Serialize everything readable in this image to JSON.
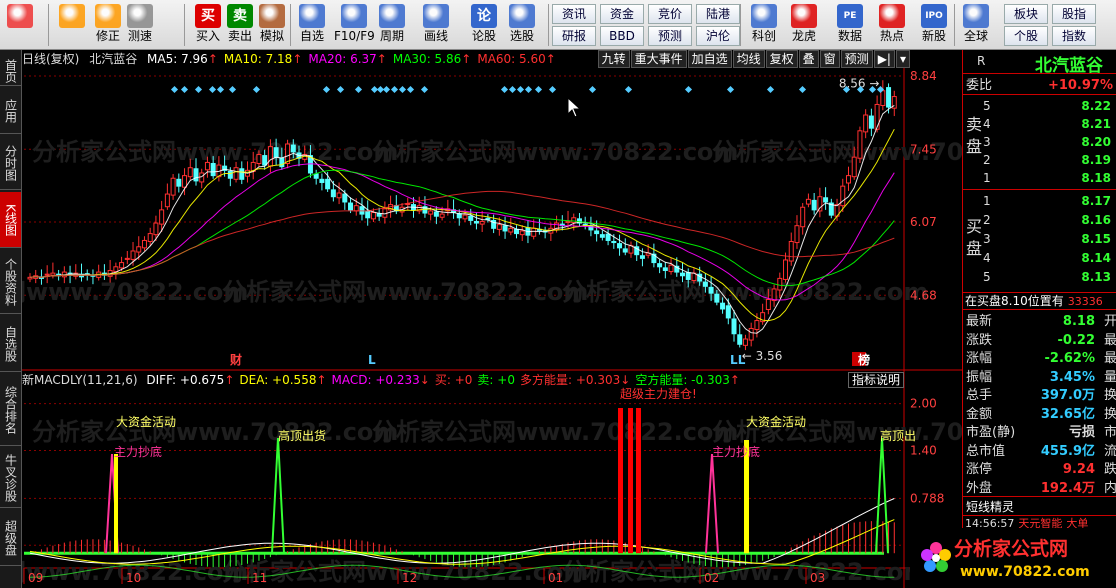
{
  "toolbar": {
    "buttons": [
      {
        "label": "",
        "icon": "windows-icon",
        "color": "#e33"
      },
      {
        "label": "",
        "icon": "back-arrow-icon",
        "color": "#f90"
      },
      {
        "label": "修正",
        "icon": "up-down-arrow-icon",
        "color": "#f90"
      },
      {
        "label": "测速",
        "icon": "clock-icon",
        "color": "#888"
      },
      {
        "label": "买入",
        "icon": "buy-icon",
        "color": "#d00",
        "glyph": "买"
      },
      {
        "label": "卖出",
        "icon": "sell-icon",
        "color": "#080",
        "glyph": "卖"
      },
      {
        "label": "模拟",
        "icon": "hammer-icon",
        "color": "#a52"
      },
      {
        "label": "自选",
        "icon": "star-icon",
        "color": "#36c"
      },
      {
        "label": "F10/F9",
        "icon": "f10-icon",
        "color": "#36c"
      },
      {
        "label": "周期",
        "icon": "period-icon",
        "color": "#36c"
      },
      {
        "label": "画线",
        "icon": "pencil-icon",
        "color": "#36c"
      },
      {
        "label": "论股",
        "icon": "discuss-icon",
        "color": "#36c",
        "glyph": "论"
      },
      {
        "label": "选股",
        "icon": "select-stock-icon",
        "color": "#36c"
      },
      {
        "label": "科创",
        "icon": "chart-icon",
        "color": "#36c"
      },
      {
        "label": "龙虎",
        "icon": "dragon-icon",
        "color": "#d00"
      },
      {
        "label": "数据",
        "icon": "pe-icon",
        "color": "#36c",
        "glyph": "PE"
      },
      {
        "label": "热点",
        "icon": "hot-icon",
        "color": "#d00"
      },
      {
        "label": "新股",
        "icon": "ipo-icon",
        "color": "#36c",
        "glyph": "IPO"
      },
      {
        "label": "全球",
        "icon": "globe-icon",
        "color": "#36c"
      }
    ],
    "small": [
      "资讯",
      "资金",
      "竞价",
      "陆港",
      "研报",
      "BBD",
      "预测",
      "沪伦",
      "板块",
      "股指",
      "个股",
      "指数"
    ]
  },
  "left_tabs": [
    {
      "label": "首页",
      "active": false
    },
    {
      "label": "应用",
      "active": false
    },
    {
      "label": "分时图",
      "active": false
    },
    {
      "label": "K线图",
      "active": true
    },
    {
      "label": "个股资料",
      "active": false
    },
    {
      "label": "自选股",
      "active": false
    },
    {
      "label": "综合排名",
      "active": false
    },
    {
      "label": "牛叉诊股",
      "active": false
    },
    {
      "label": "超级盘",
      "active": false
    }
  ],
  "kline_header": {
    "period": "日线(复权)",
    "stock": "北汽蓝谷",
    "ma": [
      {
        "label": "MA5: 7.96",
        "color": "#ffffff",
        "arrow": "↑"
      },
      {
        "label": "MA10: 7.18",
        "color": "#ffff00",
        "arrow": "↑"
      },
      {
        "label": "MA20: 6.37",
        "color": "#ff00ff",
        "arrow": "↑"
      },
      {
        "label": "MA30: 5.86",
        "color": "#00ff00",
        "arrow": "↑"
      },
      {
        "label": "MA60: 5.60",
        "color": "#ff3030",
        "arrow": "↑"
      }
    ],
    "menu": [
      "九转",
      "重大事件",
      "加自选",
      "均线",
      "复权",
      "叠",
      "窗",
      "预测",
      "▶|",
      "▾"
    ]
  },
  "chart_data": {
    "type": "candlestick",
    "price_axis": [
      "8.84",
      "7.45",
      "6.07",
      "4.68"
    ],
    "ylim": [
      3.3,
      8.84
    ],
    "high_label": "8.56",
    "low_label": "3.56",
    "markers": [
      "财",
      "L",
      "L",
      "L",
      "榜"
    ],
    "x_ticks": [
      "09",
      "10",
      "11",
      "12",
      "01",
      "02",
      "03"
    ],
    "macd_axis": [
      "2.00",
      "1.40",
      "0.788",
      "0.189"
    ],
    "macd_annotations": [
      "大资金活动",
      "主力抄底",
      "高顶出货",
      "超级主力建仓!",
      "大资金活动",
      "主力抄底",
      "高顶出"
    ],
    "closes": [
      5.02,
      5.05,
      5.0,
      5.08,
      5.1,
      5.05,
      5.12,
      5.06,
      5.1,
      5.03,
      5.08,
      5.04,
      5.12,
      5.06,
      5.15,
      5.22,
      5.3,
      5.38,
      5.52,
      5.6,
      5.72,
      5.85,
      6.05,
      6.3,
      6.6,
      6.9,
      6.75,
      6.95,
      7.1,
      6.85,
      7.0,
      7.2,
      6.95,
      7.15,
      7.05,
      6.9,
      7.1,
      6.88,
      7.05,
      7.2,
      7.35,
      7.15,
      7.5,
      7.3,
      7.12,
      7.55,
      7.4,
      7.28,
      7.35,
      7.0,
      6.9,
      6.82,
      6.7,
      6.55,
      6.62,
      6.45,
      6.3,
      6.38,
      6.22,
      6.15,
      6.25,
      6.18,
      6.32,
      6.4,
      6.28,
      6.35,
      6.42,
      6.3,
      6.38,
      6.24,
      6.28,
      6.18,
      6.22,
      6.32,
      6.25,
      6.15,
      6.2,
      6.1,
      6.05,
      6.08,
      6.12,
      5.95,
      6.02,
      5.9,
      5.95,
      5.85,
      5.9,
      5.82,
      5.95,
      5.92,
      5.88,
      5.95,
      6.05,
      6.0,
      6.08,
      6.15,
      6.05,
      6.02,
      5.92,
      5.85,
      5.78,
      5.72,
      5.68,
      5.58,
      5.5,
      5.62,
      5.45,
      5.38,
      5.48,
      5.3,
      5.22,
      5.15,
      5.25,
      5.12,
      5.05,
      4.98,
      5.1,
      4.95,
      4.85,
      4.72,
      4.55,
      4.42,
      4.25,
      3.95,
      3.75,
      3.85,
      4.05,
      4.2,
      4.35,
      4.6,
      4.8,
      5.0,
      5.35,
      5.7,
      6.0,
      6.35,
      6.5,
      6.3,
      6.55,
      6.45,
      6.2,
      6.4,
      6.75,
      6.95,
      7.3,
      7.8,
      8.1,
      7.85,
      8.3,
      8.56,
      8.25,
      8.45
    ],
    "series_colors": {
      "ma5": "#ffffff",
      "ma10": "#ffff00",
      "ma20": "#ff00ff",
      "ma30": "#00ff00",
      "ma60": "#ff3030"
    }
  },
  "macd_header": {
    "name": "新MACDLY(11,21,6)",
    "items": [
      {
        "label": "DIFF: +0.675",
        "color": "#ffffff",
        "arrow": "↑"
      },
      {
        "label": "DEA: +0.558",
        "color": "#ffff00",
        "arrow": "↑"
      },
      {
        "label": "MACD: +0.233",
        "color": "#ff00ff",
        "arrow": "↓"
      },
      {
        "label": "买: +0",
        "color": "#ff3030",
        "arrow": ""
      },
      {
        "label": "卖: +0",
        "color": "#00ff00",
        "arrow": ""
      },
      {
        "label": "多方能量: +0.303",
        "color": "#ff3030",
        "arrow": "↓"
      },
      {
        "label": "空方能量: -0.303",
        "color": "#00ff00",
        "arrow": "↑"
      }
    ],
    "button": "指标说明"
  },
  "right_panel": {
    "title": "北汽蓝谷",
    "r_label": "R",
    "weibi_label": "委比",
    "weibi_value": "+10.97%",
    "sell_label": "卖盘",
    "buy_label": "买盘",
    "sell": [
      {
        "n": "5",
        "p": "8.22",
        "a": ""
      },
      {
        "n": "4",
        "p": "8.21",
        "a": ""
      },
      {
        "n": "3",
        "p": "8.20",
        "a": ""
      },
      {
        "n": "2",
        "p": "8.19",
        "a": ""
      },
      {
        "n": "1",
        "p": "8.18",
        "a": ""
      }
    ],
    "buy": [
      {
        "n": "1",
        "p": "8.17",
        "a": ""
      },
      {
        "n": "2",
        "p": "8.16",
        "a": ""
      },
      {
        "n": "3",
        "p": "8.15",
        "a": ""
      },
      {
        "n": "4",
        "p": "8.14",
        "a": ""
      },
      {
        "n": "5",
        "p": "8.13",
        "a": ""
      }
    ],
    "status_line": "在买盘8.10位置有",
    "status_num": "33336",
    "stats": [
      {
        "k": "最新",
        "v": "8.18",
        "e": "开",
        "color": "#33ff33"
      },
      {
        "k": "涨跌",
        "v": "-0.22",
        "e": "最",
        "color": "#33ff33"
      },
      {
        "k": "涨幅",
        "v": "-2.62%",
        "e": "最",
        "color": "#33ff33"
      },
      {
        "k": "振幅",
        "v": "3.45%",
        "e": "量",
        "color": "#33ccff"
      },
      {
        "k": "总手",
        "v": "397.0万",
        "e": "换",
        "color": "#33ccff"
      },
      {
        "k": "金额",
        "v": "32.65亿",
        "e": "换",
        "color": "#33ccff"
      },
      {
        "k": "市盈(静)",
        "v": "亏损",
        "e": "市",
        "color": "#dddddd"
      },
      {
        "k": "总市值",
        "v": "455.9亿",
        "e": "流",
        "color": "#33ccff"
      },
      {
        "k": "涨停",
        "v": "9.24",
        "e": "跌",
        "color": "#ff3030"
      },
      {
        "k": "外盘",
        "v": "192.4万",
        "e": "内",
        "color": "#ff3030"
      }
    ],
    "shortline_title": "短线精灵",
    "shortline_row": {
      "time": "14:56:57",
      "name": "天元智能",
      "msg": "大单"
    }
  },
  "watermark": "分析家公式网www.70822.com",
  "logo": {
    "text": "分析家公式网",
    "url": "www.70822.com"
  }
}
